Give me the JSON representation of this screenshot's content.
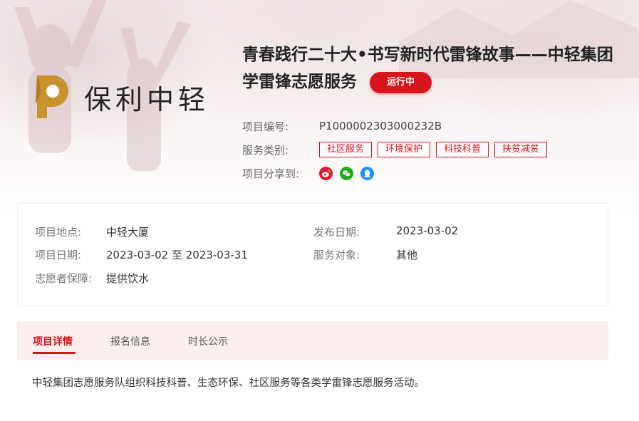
{
  "project": {
    "title": "青春践行二十大•书写新时代雷锋故事——中轻集团学雷锋志愿服务",
    "status": "运行中",
    "logo_text": "保利中轻"
  },
  "meta": {
    "id_label": "项目编号:",
    "id_value": "P1000002303000232B",
    "category_label": "服务类别:",
    "categories": [
      "社区服务",
      "环境保护",
      "科技科普",
      "扶贫减贫"
    ],
    "share_label": "项目分享到:",
    "share_icons": [
      "weibo-icon",
      "wechat-icon",
      "qq-icon"
    ]
  },
  "info": {
    "location_label": "项目地点:",
    "location_value": "中轻大厦",
    "date_label": "项目日期:",
    "date_value": "2023-03-02 至 2023-03-31",
    "guarantee_label": "志愿者保障:",
    "guarantee_value": "提供饮水",
    "publish_label": "发布日期:",
    "publish_value": "2023-03-02",
    "target_label": "服务对象:",
    "target_value": "其他"
  },
  "tabs": [
    {
      "label": "项目详情",
      "active": true
    },
    {
      "label": "报名信息",
      "active": false
    },
    {
      "label": "时长公示",
      "active": false
    }
  ],
  "detail_text": "中轻集团志愿服务队组织科技科普、生态环保、社区服务等各类学雷锋志愿服务活动。",
  "colors": {
    "accent": "#d6141c",
    "logo_gold": "#c8922e",
    "weibo": "#e6162d",
    "wechat": "#1aad19",
    "qq": "#1e90ff"
  }
}
